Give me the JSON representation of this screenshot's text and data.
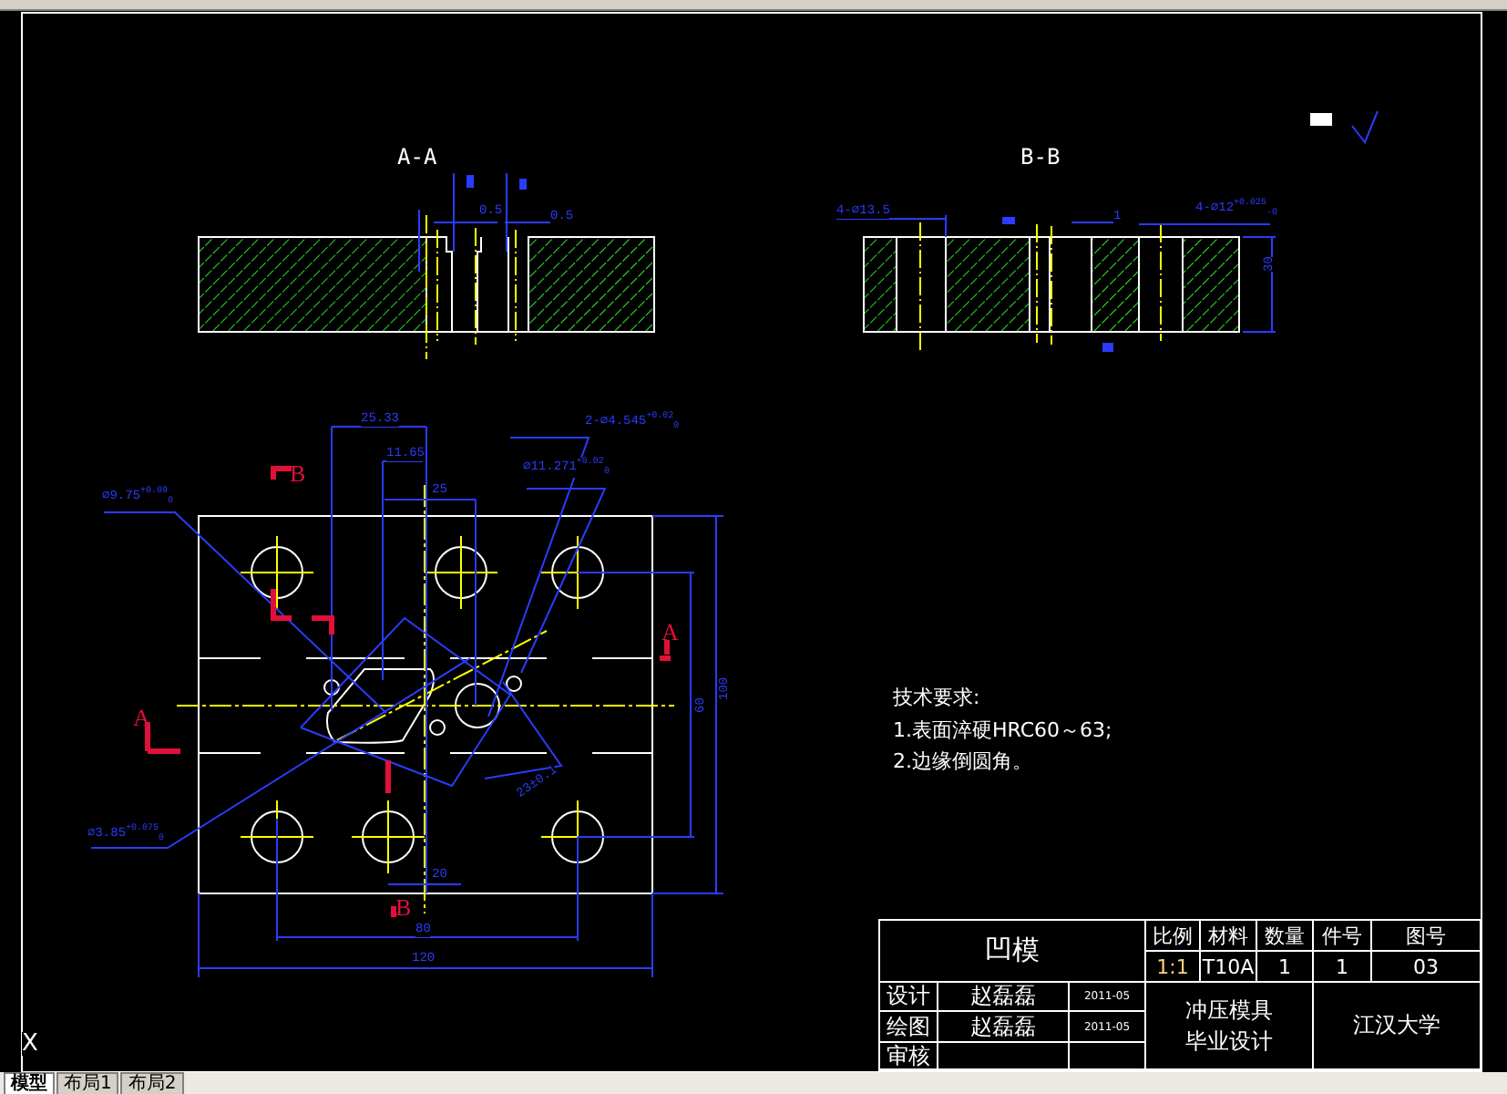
{
  "section_views": [
    {
      "title": "A-A"
    },
    {
      "title": "B-B"
    }
  ],
  "section_a_dimensions": [
    "0.5",
    "0.5"
  ],
  "section_b_dimensions": [
    "4-⌀13.5",
    "1",
    "4-⌀12$^{+0.025}$$_{-0}$",
    "30"
  ],
  "plan_dimensions": [
    "25.33",
    "11.65",
    "25",
    "⌀9.75$^{+0.09}$$_{0}$",
    "2-⌀4.545$^{+0.02}$$_{0}$",
    "⌀11.271$^{+0.02}$$_{0}$",
    "⌀3.85$^{+0.075}$$_{0}$",
    "20",
    "80",
    "100",
    "60",
    "120",
    "23±0.1"
  ],
  "section_markers": [
    {
      "letter": "B"
    },
    {
      "letter": "A"
    },
    {
      "letter": "A"
    },
    {
      "letter": "B"
    }
  ],
  "technical_requirements": {
    "title": "技术要求:",
    "items": [
      "1.表面淬硬HRC60～63;",
      "2.边缘倒圆角。"
    ]
  },
  "title_block": {
    "part_name": "凹模",
    "headers": [
      "比例",
      "材料",
      "数量",
      "件号",
      "图号"
    ],
    "values": [
      "1:1",
      "T10A",
      "1",
      "1",
      "03"
    ],
    "staff": [
      {
        "role": "设计",
        "name": "赵磊磊",
        "date": "2011-05"
      },
      {
        "role": "绘图",
        "name": "赵磊磊",
        "date": "2011-05"
      },
      {
        "role": "审核"
      }
    ],
    "project": [
      "冲压模具",
      "毕业设计"
    ],
    "school": "江汉大学"
  },
  "ucs_label": "X",
  "layout_tabs": [
    {
      "label": "模型",
      "selected": true
    },
    {
      "label": "布局1",
      "selected": false
    },
    {
      "label": "布局2",
      "selected": false
    }
  ]
}
